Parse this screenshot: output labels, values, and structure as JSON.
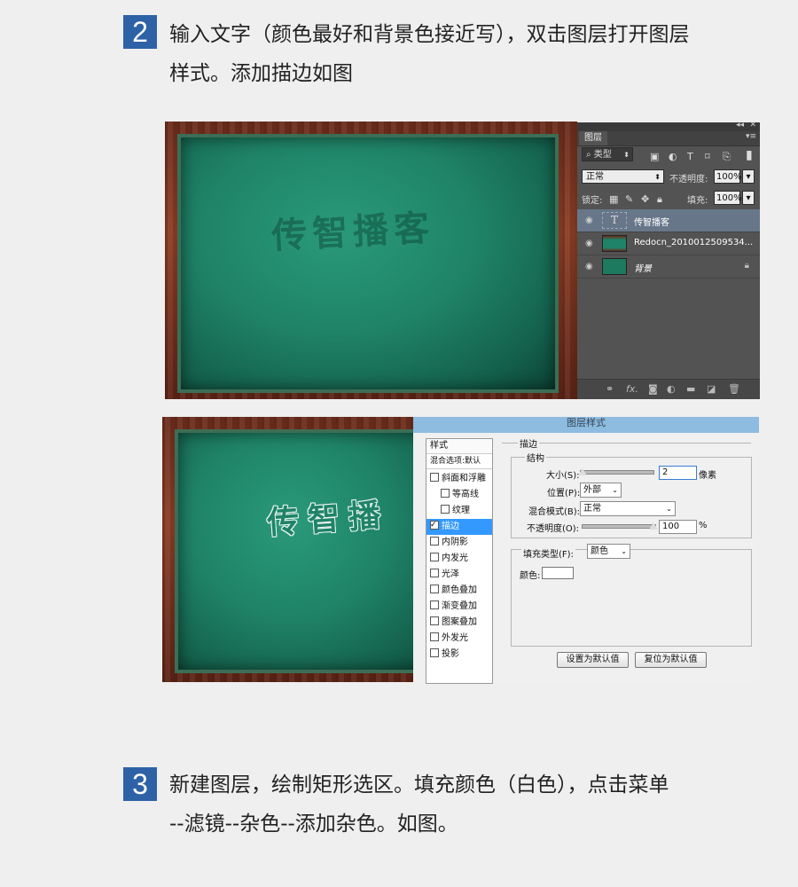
{
  "step2": {
    "number": "2",
    "line1": "输入文字（颜色最好和背景色接近写），双击图层打开图层",
    "line2": "样式。添加描边如图"
  },
  "step3": {
    "number": "3",
    "line1": "新建图层，绘制矩形选区。填充颜色（白色），点击菜单",
    "line2": "--滤镜--杂色--添加杂色。如图。"
  },
  "screenshot1": {
    "chalk_text": "传智播客",
    "panel": {
      "tab": "图层",
      "filter_label": "类型",
      "blend_mode": "正常",
      "opacity_label": "不透明度:",
      "opacity_value": "100%",
      "lock_label": "锁定:",
      "fill_label": "填充:",
      "fill_value": "100%",
      "layers": [
        {
          "name": "传智播客",
          "type": "text",
          "selected": true
        },
        {
          "name": "Redocn_2010012509534...",
          "type": "image",
          "selected": false
        },
        {
          "name": "背景",
          "type": "background",
          "selected": false
        }
      ],
      "footer_fx": "fx."
    }
  },
  "screenshot2": {
    "chalk_text": "传智播",
    "dialog": {
      "title": "图层样式",
      "styles_header": "样式",
      "blend_options": "混合选项:默认",
      "style_items": [
        {
          "label": "斜面和浮雕",
          "checked": false,
          "indent": false,
          "active": false
        },
        {
          "label": "等高线",
          "checked": false,
          "indent": true,
          "active": false
        },
        {
          "label": "纹理",
          "checked": false,
          "indent": true,
          "active": false
        },
        {
          "label": "描边",
          "checked": true,
          "indent": false,
          "active": true
        },
        {
          "label": "内阴影",
          "checked": false,
          "indent": false,
          "active": false
        },
        {
          "label": "内发光",
          "checked": false,
          "indent": false,
          "active": false
        },
        {
          "label": "光泽",
          "checked": false,
          "indent": false,
          "active": false
        },
        {
          "label": "颜色叠加",
          "checked": false,
          "indent": false,
          "active": false
        },
        {
          "label": "渐变叠加",
          "checked": false,
          "indent": false,
          "active": false
        },
        {
          "label": "图案叠加",
          "checked": false,
          "indent": false,
          "active": false
        },
        {
          "label": "外发光",
          "checked": false,
          "indent": false,
          "active": false
        },
        {
          "label": "投影",
          "checked": false,
          "indent": false,
          "active": false
        }
      ],
      "stroke_section": "描边",
      "structure_section": "结构",
      "size_label": "大小(S):",
      "size_value": "2",
      "size_unit": "像素",
      "position_label": "位置(P):",
      "position_value": "外部",
      "blend_label": "混合模式(B):",
      "blend_value": "正常",
      "opacity_label": "不透明度(O):",
      "opacity_value": "100",
      "opacity_unit": "%",
      "fill_type_label": "填充类型(F):",
      "fill_type_value": "颜色",
      "color_label": "颜色:",
      "color_value": "#ffffff",
      "btn_default": "设置为默认值",
      "btn_reset": "复位为默认值"
    }
  }
}
